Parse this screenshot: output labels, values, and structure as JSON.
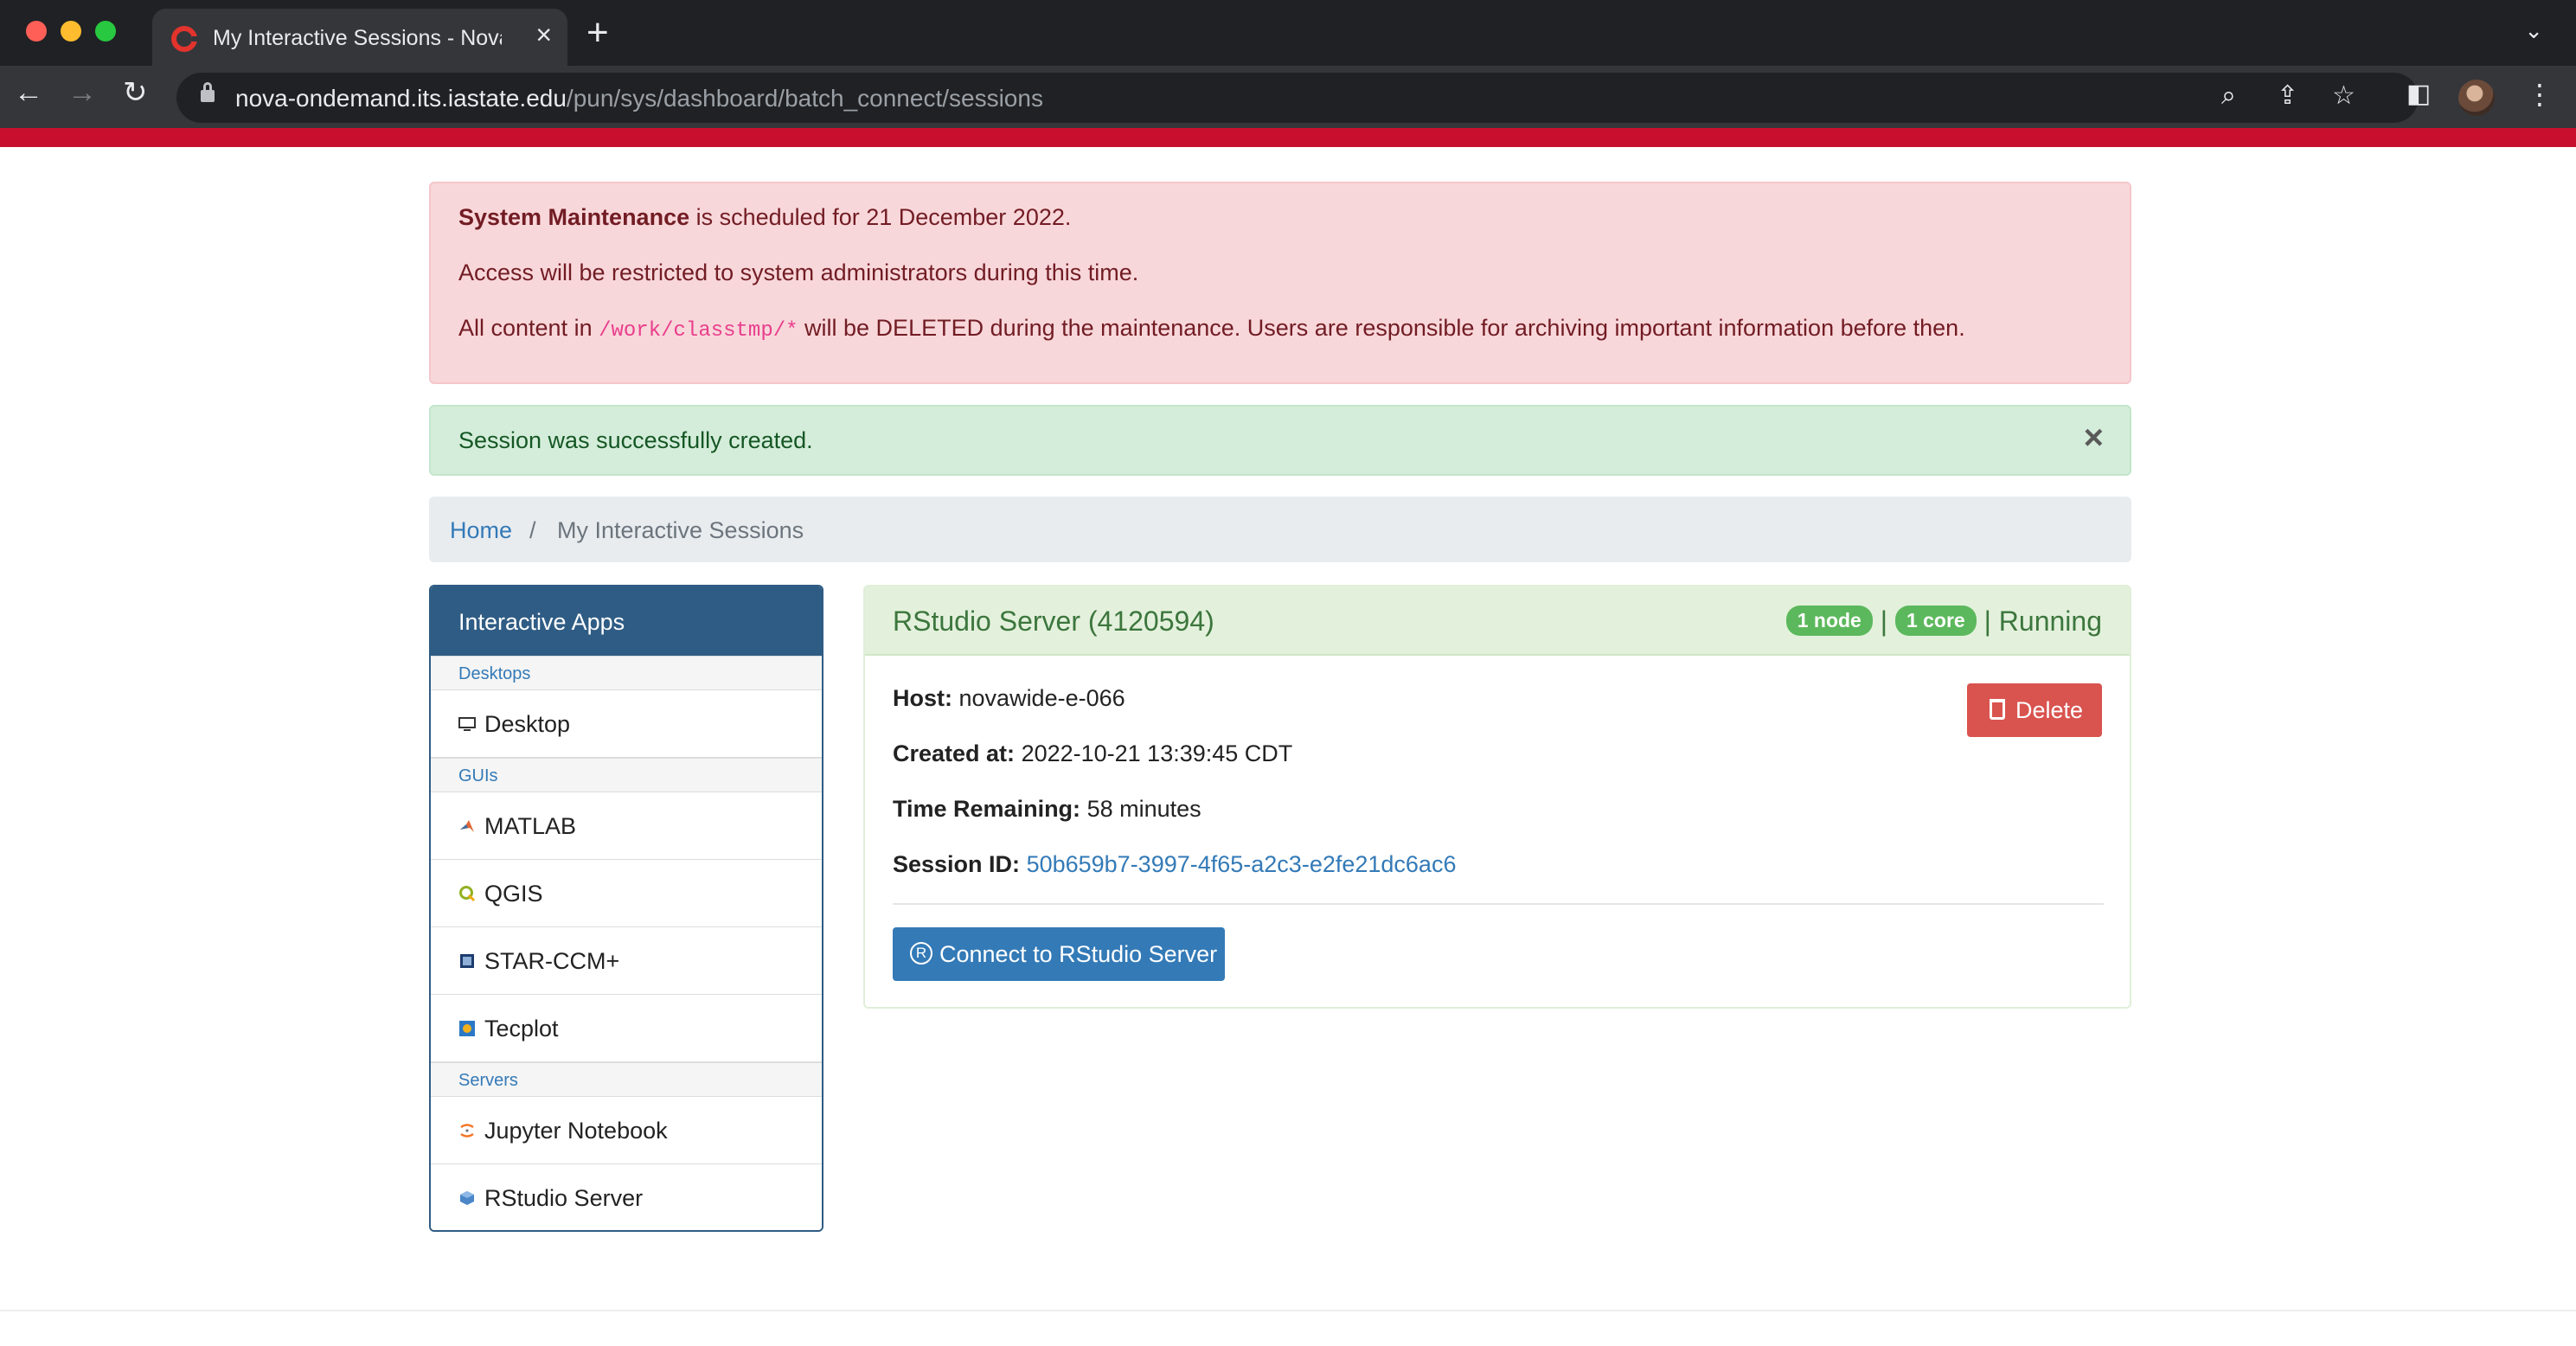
{
  "browser": {
    "tab_title": "My Interactive Sessions - Nova",
    "url_host": "nova-ondemand.its.iastate.edu",
    "url_path": "/pun/sys/dashboard/batch_connect/sessions"
  },
  "alerts": {
    "maintenance": {
      "line1_bold": "System Maintenance",
      "line1_rest": " is scheduled for 21 December 2022.",
      "line2": "Access will be restricted to system administrators during this time.",
      "line3_pre": "All content in ",
      "line3_code": "/work/classtmp/*",
      "line3_post": " will be DELETED during the maintenance. Users are responsible for archiving important information before then."
    },
    "success": "Session was successfully created."
  },
  "breadcrumb": {
    "home": "Home",
    "separator": "/",
    "current": "My Interactive Sessions"
  },
  "sidebar": {
    "title": "Interactive Apps",
    "categories": [
      "Desktops",
      "GUIs",
      "Servers"
    ],
    "items": [
      {
        "label": "Desktop",
        "icon": "monitor-icon"
      },
      {
        "label": "MATLAB",
        "icon": "matlab-icon"
      },
      {
        "label": "QGIS",
        "icon": "qgis-icon"
      },
      {
        "label": "STAR-CCM+",
        "icon": "star-ccm-icon"
      },
      {
        "label": "Tecplot",
        "icon": "tecplot-icon"
      },
      {
        "label": "Jupyter Notebook",
        "icon": "jupyter-icon"
      },
      {
        "label": "RStudio Server",
        "icon": "rstudio-icon"
      }
    ]
  },
  "session": {
    "title": "RStudio Server (4120594)",
    "nodes": "1 node",
    "cores": "1 core",
    "divider": "|",
    "status": "Running",
    "host_label": "Host:",
    "host": "novawide-e-066",
    "created_label": "Created at:",
    "created": "2022-10-21 13:39:45 CDT",
    "remaining_label": "Time Remaining:",
    "remaining": "58 minutes",
    "id_label": "Session ID:",
    "id": "50b659b7-3997-4f65-a2c3-e2fe21dc6ac6",
    "delete_label": "Delete",
    "connect_label": "Connect to RStudio Server",
    "connect_icon_letter": "R"
  },
  "colors": {
    "brand_red": "#c8102e",
    "panel_blue": "#2f5c84",
    "success_green": "#5cb85c",
    "danger": "#d9534f",
    "primary": "#337ab7"
  }
}
